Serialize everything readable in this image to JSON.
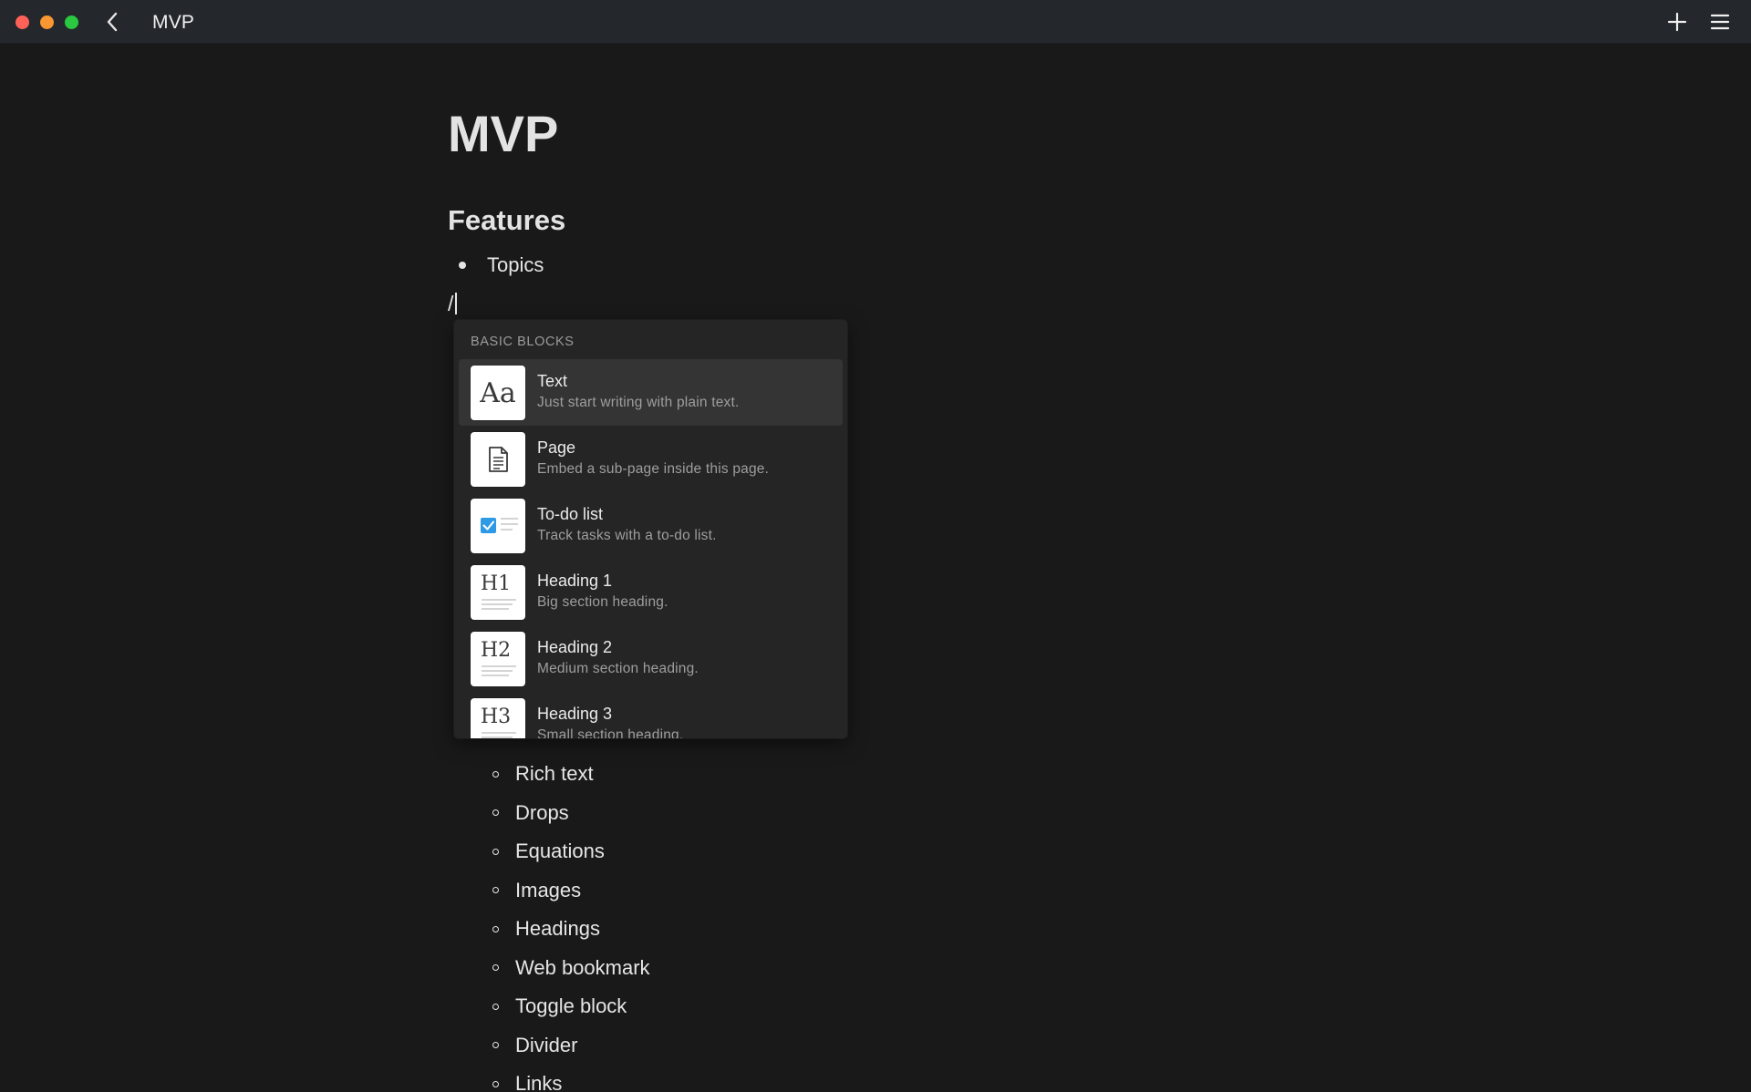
{
  "window": {
    "title": "MVP"
  },
  "icons": {
    "back": "chevron-left-icon",
    "new": "plus-icon",
    "menu": "hamburger-menu-icon"
  },
  "document": {
    "title": "MVP",
    "section_heading": "Features",
    "bullets": [
      "Topics"
    ],
    "slash_input": "/",
    "sub_items": [
      "Rich text",
      "Drops",
      "Equations",
      "Images",
      "Headings",
      "Web bookmark",
      "Toggle block",
      "Divider",
      "Links"
    ]
  },
  "slash_menu": {
    "header": "BASIC BLOCKS",
    "items": [
      {
        "label": "Text",
        "description": "Just start writing with plain text.",
        "icon": "text-block-icon",
        "icon_text": "Aa",
        "selected": true
      },
      {
        "label": "Page",
        "description": "Embed a sub-page inside this page.",
        "icon": "page-icon"
      },
      {
        "label": "To-do list",
        "description": "Track tasks with a to-do list.",
        "icon": "todo-checkbox-icon"
      },
      {
        "label": "Heading 1",
        "description": "Big section heading.",
        "icon": "heading-1-icon",
        "icon_text": "H1"
      },
      {
        "label": "Heading 2",
        "description": "Medium section heading.",
        "icon": "heading-2-icon",
        "icon_text": "H2"
      },
      {
        "label": "Heading 3",
        "description": "Small section heading.",
        "icon": "heading-3-icon",
        "icon_text": "H3"
      }
    ]
  },
  "colors": {
    "background": "#191919",
    "titlebar": "#24272c",
    "menu_background": "#252525",
    "menu_selected": "#343434",
    "checkbox_accent": "#2e9ae6"
  }
}
